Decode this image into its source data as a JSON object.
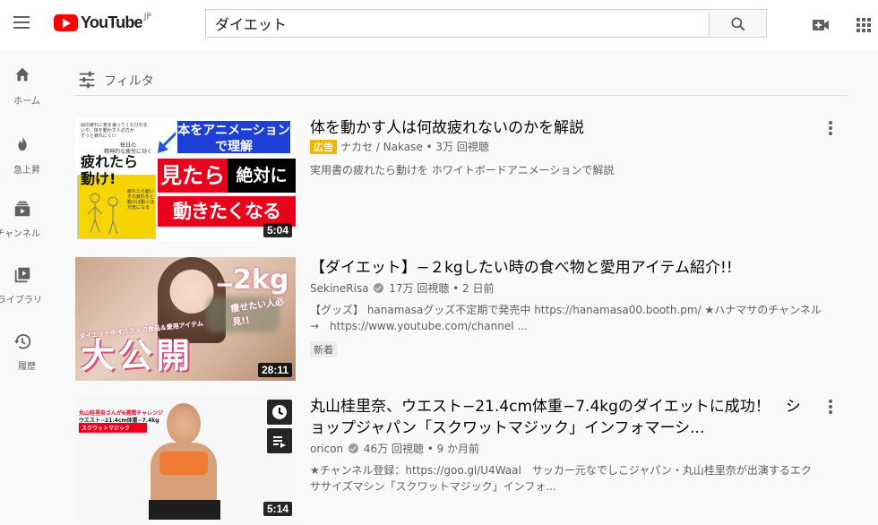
{
  "header": {
    "logo_text": "YouTube",
    "country": "JP",
    "search_value": "ダイエット"
  },
  "sidebar": {
    "items": [
      {
        "label": "ホーム",
        "icon": "home-icon"
      },
      {
        "label": "急上昇",
        "icon": "fire-icon"
      },
      {
        "label": "登録チャンネル",
        "icon": "subscriptions-icon"
      },
      {
        "label": "ライブラリ",
        "icon": "library-icon"
      },
      {
        "label": "履歴",
        "icon": "history-icon"
      }
    ]
  },
  "filter": {
    "label": "フィルタ"
  },
  "results": [
    {
      "title": "体を動かす人は何故疲れないのかを解説",
      "ad_label": "広告",
      "meta": "ナカセ / Nakase • 3万 回視聴",
      "desc": "実用書の疲れたら動けを ホワイトボードアニメーションで解説",
      "duration": "5:04",
      "thumb_texts": {
        "banner": "本をアニメーション\nで理解",
        "book_small_1": "頭の疲れに気を遣ってくたびれる\nいや、体を動かす人の方が\nずっと疲れにくい",
        "book_small_2": "毎日の\n精神的な疲労に効く",
        "book_title": "疲れたら\n動け!",
        "book_side": "疲れたら動いて\nその疲れをとる\n動けば動くほど\n元気になる",
        "red_1": "見たら",
        "black_1": "絶対に",
        "red_2": "動きたくなる"
      }
    },
    {
      "title": "【ダイエット】−２kgしたい時の食べ物と愛用アイテム紹介!!",
      "channel": "SekineRisa",
      "meta": "17万 回視聴 • 2 日前",
      "desc_line1": "【グッズ】 hanamasaグッズ不定期で発売中 https://hanamasa00.booth.pm/ ★ハナマサのチャンネル",
      "desc_line2": "→　https://www.youtube.com/channel ...",
      "badge": "新着",
      "duration": "28:11",
      "thumb_texts": {
        "minus": "−",
        "kg": "2kg",
        "sub": "痩せたい人必見!!",
        "strip": "ダイエット中オススメの食品＆愛用アイテム",
        "big": "大公開"
      }
    },
    {
      "title": "丸山桂里奈、ウエスト−21.4cm体重−7.4kgのダイエットに成功！　ショップジャパン「スクワットマジック」インフォマーシ...",
      "channel": "oricon",
      "meta": "46万 回視聴 • 9 か月前",
      "desc_line1": "★チャンネル登録：https://goo.gl/U4Waal　サッカー元なでしこジャパン・丸山桂里奈が出演するエク",
      "desc_line2": "ササイズマシン「スクワットマジック」インフォ...",
      "duration": "5:14",
      "thumb_texts": {
        "line1": "丸山桂里奈さんが6週間チャレンジ",
        "line2": "ウエスト−21.4cm体重−7.4kg",
        "line3": "スクワットマジック"
      }
    }
  ]
}
